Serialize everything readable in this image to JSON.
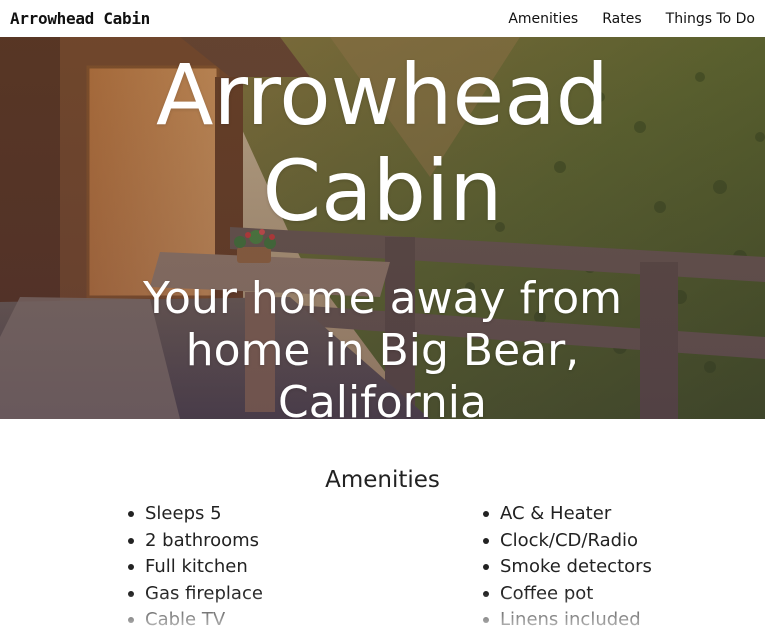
{
  "nav": {
    "brand": "Arrowhead Cabin",
    "links": [
      {
        "label": "Amenities"
      },
      {
        "label": "Rates"
      },
      {
        "label": "Things To Do"
      }
    ]
  },
  "hero": {
    "title": "Arrowhead Cabin",
    "subtitle": "Your home away from home in Big Bear, California"
  },
  "amenities": {
    "heading": "Amenities",
    "left": [
      "Sleeps 5",
      "2 bathrooms",
      "Full kitchen",
      "Gas fireplace",
      "Cable TV"
    ],
    "right": [
      "AC & Heater",
      "Clock/CD/Radio",
      "Smoke detectors",
      "Coffee pot",
      "Linens included"
    ]
  }
}
